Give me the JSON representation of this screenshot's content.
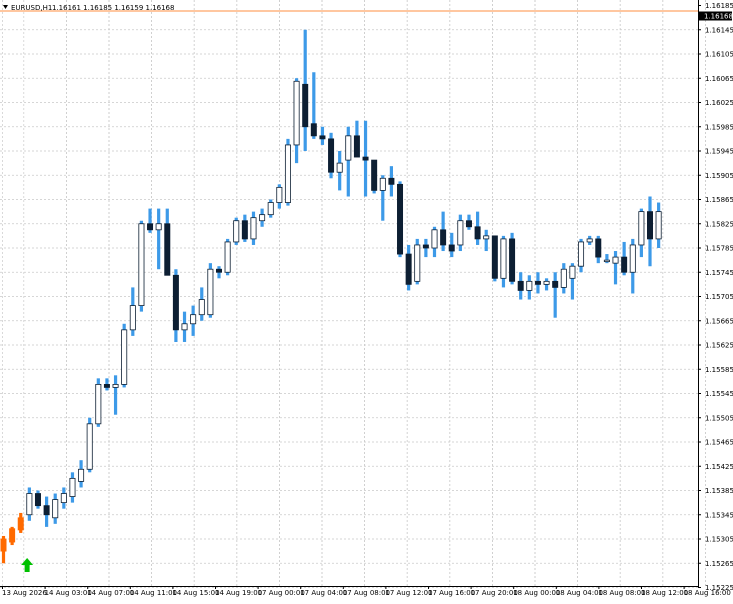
{
  "header": {
    "symbol_timeframe": "EURUSD,H1",
    "ohlc": "1.16161 1.16185 1.16159 1.16168"
  },
  "current_price_label": "1.16168",
  "price_labels": [
    "1.16185",
    "1.16145",
    "1.16105",
    "1.16065",
    "1.16025",
    "1.15985",
    "1.15945",
    "1.15905",
    "1.15865",
    "1.15825",
    "1.15785",
    "1.15745",
    "1.15705",
    "1.15665",
    "1.15625",
    "1.15585",
    "1.15545",
    "1.15505",
    "1.15465",
    "1.15425",
    "1.15385",
    "1.15345",
    "1.15305",
    "1.15265",
    "1.15225"
  ],
  "time_labels": [
    "13 Aug 2026",
    "14 Aug 03:00",
    "14 Aug 07:00",
    "14 Aug 11:00",
    "14 Aug 15:00",
    "14 Aug 19:00",
    "17 Aug 00:00",
    "17 Aug 04:00",
    "17 Aug 08:00",
    "17 Aug 12:00",
    "17 Aug 16:00",
    "17 Aug 20:00",
    "18 Aug 00:00",
    "18 Aug 04:00",
    "18 Aug 08:00",
    "18 Aug 12:00",
    "18 Aug 16:00"
  ],
  "colors": {
    "bull_wick": "#3d9ae8",
    "bear_body": "#0d1f33",
    "highlight": "#ff6a00",
    "grid": "#c9c9c9",
    "axis": "#000000",
    "current_price": "#000000",
    "buy_arrow": "#00c000"
  },
  "chart_data": {
    "type": "candlestick",
    "symbol": "EURUSD",
    "timeframe": "H1",
    "ylim": [
      1.15225,
      1.16185
    ],
    "grid": true,
    "highlighted_count": 3,
    "signals": [
      {
        "type": "buy-arrow",
        "bar": 1
      }
    ],
    "candles": [
      {
        "o": 1.15285,
        "h": 1.1531,
        "l": 1.15265,
        "c": 1.15305
      },
      {
        "o": 1.153,
        "h": 1.15325,
        "l": 1.15295,
        "c": 1.15322
      },
      {
        "o": 1.1532,
        "h": 1.15348,
        "l": 1.15315,
        "c": 1.1534
      },
      {
        "o": 1.15345,
        "h": 1.1539,
        "l": 1.15335,
        "c": 1.1538
      },
      {
        "o": 1.1538,
        "h": 1.15385,
        "l": 1.15355,
        "c": 1.1536
      },
      {
        "o": 1.1536,
        "h": 1.15375,
        "l": 1.15325,
        "c": 1.15345
      },
      {
        "o": 1.1534,
        "h": 1.1538,
        "l": 1.1533,
        "c": 1.1537
      },
      {
        "o": 1.15365,
        "h": 1.1539,
        "l": 1.15355,
        "c": 1.1538
      },
      {
        "o": 1.15375,
        "h": 1.15415,
        "l": 1.15365,
        "c": 1.15405
      },
      {
        "o": 1.154,
        "h": 1.15435,
        "l": 1.1539,
        "c": 1.1542
      },
      {
        "o": 1.1542,
        "h": 1.15505,
        "l": 1.15415,
        "c": 1.15495
      },
      {
        "o": 1.15495,
        "h": 1.1557,
        "l": 1.1549,
        "c": 1.1556
      },
      {
        "o": 1.1556,
        "h": 1.1557,
        "l": 1.1555,
        "c": 1.15555
      },
      {
        "o": 1.15555,
        "h": 1.15575,
        "l": 1.1551,
        "c": 1.1556
      },
      {
        "o": 1.1556,
        "h": 1.1566,
        "l": 1.15555,
        "c": 1.1565
      },
      {
        "o": 1.1565,
        "h": 1.1572,
        "l": 1.1564,
        "c": 1.1569
      },
      {
        "o": 1.1569,
        "h": 1.1583,
        "l": 1.1568,
        "c": 1.15825
      },
      {
        "o": 1.15825,
        "h": 1.1585,
        "l": 1.1581,
        "c": 1.15815
      },
      {
        "o": 1.15815,
        "h": 1.1585,
        "l": 1.1575,
        "c": 1.15825
      },
      {
        "o": 1.15825,
        "h": 1.1585,
        "l": 1.1574,
        "c": 1.1574
      },
      {
        "o": 1.1574,
        "h": 1.1575,
        "l": 1.1563,
        "c": 1.1565
      },
      {
        "o": 1.1565,
        "h": 1.1568,
        "l": 1.1563,
        "c": 1.1566
      },
      {
        "o": 1.1566,
        "h": 1.1569,
        "l": 1.1564,
        "c": 1.15675
      },
      {
        "o": 1.15675,
        "h": 1.1572,
        "l": 1.15665,
        "c": 1.157
      },
      {
        "o": 1.15675,
        "h": 1.1576,
        "l": 1.1567,
        "c": 1.1575
      },
      {
        "o": 1.1575,
        "h": 1.15755,
        "l": 1.15735,
        "c": 1.15745
      },
      {
        "o": 1.15745,
        "h": 1.158,
        "l": 1.1574,
        "c": 1.15795
      },
      {
        "o": 1.15795,
        "h": 1.15835,
        "l": 1.1579,
        "c": 1.1583
      },
      {
        "o": 1.1583,
        "h": 1.1584,
        "l": 1.15795,
        "c": 1.158
      },
      {
        "o": 1.158,
        "h": 1.15845,
        "l": 1.1579,
        "c": 1.15835
      },
      {
        "o": 1.1583,
        "h": 1.1585,
        "l": 1.1582,
        "c": 1.1584
      },
      {
        "o": 1.1584,
        "h": 1.15865,
        "l": 1.15835,
        "c": 1.1586
      },
      {
        "o": 1.1586,
        "h": 1.1589,
        "l": 1.1585,
        "c": 1.15885
      },
      {
        "o": 1.1586,
        "h": 1.15965,
        "l": 1.15855,
        "c": 1.15955
      },
      {
        "o": 1.15955,
        "h": 1.16065,
        "l": 1.15925,
        "c": 1.1606
      },
      {
        "o": 1.16055,
        "h": 1.16145,
        "l": 1.15945,
        "c": 1.15985
      },
      {
        "o": 1.1599,
        "h": 1.16075,
        "l": 1.15965,
        "c": 1.1597
      },
      {
        "o": 1.1597,
        "h": 1.15985,
        "l": 1.15955,
        "c": 1.15965
      },
      {
        "o": 1.15965,
        "h": 1.15975,
        "l": 1.159,
        "c": 1.1591
      },
      {
        "o": 1.1591,
        "h": 1.15945,
        "l": 1.1588,
        "c": 1.15925
      },
      {
        "o": 1.1593,
        "h": 1.15985,
        "l": 1.1587,
        "c": 1.1597
      },
      {
        "o": 1.1597,
        "h": 1.15995,
        "l": 1.15935,
        "c": 1.15935
      },
      {
        "o": 1.15935,
        "h": 1.15995,
        "l": 1.1587,
        "c": 1.1593
      },
      {
        "o": 1.1593,
        "h": 1.1593,
        "l": 1.15875,
        "c": 1.1588
      },
      {
        "o": 1.1588,
        "h": 1.15905,
        "l": 1.1583,
        "c": 1.159
      },
      {
        "o": 1.159,
        "h": 1.1592,
        "l": 1.1587,
        "c": 1.1589
      },
      {
        "o": 1.1589,
        "h": 1.15895,
        "l": 1.1577,
        "c": 1.15775
      },
      {
        "o": 1.15775,
        "h": 1.1579,
        "l": 1.15715,
        "c": 1.15725
      },
      {
        "o": 1.1573,
        "h": 1.158,
        "l": 1.15725,
        "c": 1.1579
      },
      {
        "o": 1.1579,
        "h": 1.158,
        "l": 1.1577,
        "c": 1.15785
      },
      {
        "o": 1.15785,
        "h": 1.1582,
        "l": 1.1577,
        "c": 1.15815
      },
      {
        "o": 1.15815,
        "h": 1.15845,
        "l": 1.1578,
        "c": 1.1579
      },
      {
        "o": 1.1579,
        "h": 1.1581,
        "l": 1.1577,
        "c": 1.1578
      },
      {
        "o": 1.1579,
        "h": 1.1584,
        "l": 1.1578,
        "c": 1.1583
      },
      {
        "o": 1.1583,
        "h": 1.1584,
        "l": 1.15815,
        "c": 1.1582
      },
      {
        "o": 1.1582,
        "h": 1.15845,
        "l": 1.1579,
        "c": 1.158
      },
      {
        "o": 1.158,
        "h": 1.15815,
        "l": 1.1578,
        "c": 1.15805
      },
      {
        "o": 1.15805,
        "h": 1.15805,
        "l": 1.1573,
        "c": 1.15735
      },
      {
        "o": 1.15735,
        "h": 1.15805,
        "l": 1.1572,
        "c": 1.158
      },
      {
        "o": 1.158,
        "h": 1.1581,
        "l": 1.15725,
        "c": 1.1573
      },
      {
        "o": 1.1573,
        "h": 1.15745,
        "l": 1.157,
        "c": 1.15715
      },
      {
        "o": 1.15715,
        "h": 1.1574,
        "l": 1.157,
        "c": 1.1573
      },
      {
        "o": 1.1573,
        "h": 1.15745,
        "l": 1.1571,
        "c": 1.15725
      },
      {
        "o": 1.15725,
        "h": 1.15735,
        "l": 1.15715,
        "c": 1.1573
      },
      {
        "o": 1.1573,
        "h": 1.15745,
        "l": 1.1567,
        "c": 1.1572
      },
      {
        "o": 1.1572,
        "h": 1.1576,
        "l": 1.1571,
        "c": 1.1575
      },
      {
        "o": 1.15735,
        "h": 1.1576,
        "l": 1.157,
        "c": 1.15755
      },
      {
        "o": 1.15755,
        "h": 1.158,
        "l": 1.15745,
        "c": 1.15795
      },
      {
        "o": 1.15795,
        "h": 1.15805,
        "l": 1.1579,
        "c": 1.158
      },
      {
        "o": 1.158,
        "h": 1.15805,
        "l": 1.1576,
        "c": 1.1577
      },
      {
        "o": 1.15765,
        "h": 1.15775,
        "l": 1.1576,
        "c": 1.15765
      },
      {
        "o": 1.1576,
        "h": 1.1578,
        "l": 1.15725,
        "c": 1.1577
      },
      {
        "o": 1.1577,
        "h": 1.15795,
        "l": 1.1574,
        "c": 1.15745
      },
      {
        "o": 1.15745,
        "h": 1.158,
        "l": 1.1571,
        "c": 1.1579
      },
      {
        "o": 1.1579,
        "h": 1.1585,
        "l": 1.1577,
        "c": 1.15845
      },
      {
        "o": 1.15845,
        "h": 1.1587,
        "l": 1.15755,
        "c": 1.158
      },
      {
        "o": 1.158,
        "h": 1.1586,
        "l": 1.15785,
        "c": 1.15845
      }
    ]
  }
}
